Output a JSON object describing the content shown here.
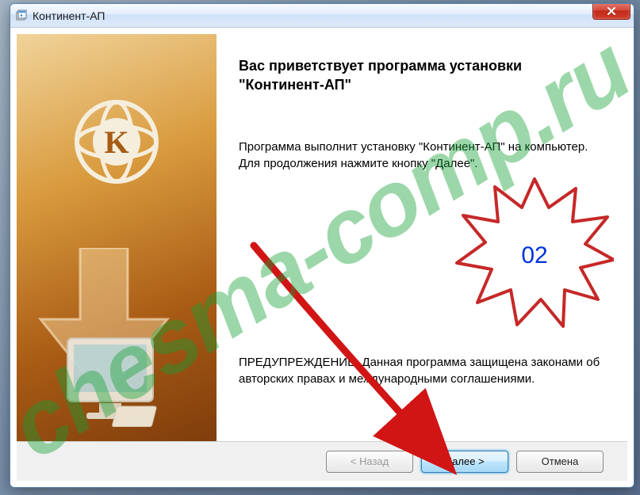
{
  "titlebar": {
    "title": "Континент-АП"
  },
  "wizard": {
    "heading": "Вас приветствует программа установки \"Континент-АП\"",
    "intro": "Программа выполнит установку \"Континент-АП\" на компьютер. Для продолжения нажмите кнопку \"Далее\".",
    "warning": "ПРЕДУПРЕЖДЕНИЕ. Данная программа защищена законами об авторских правах и международными соглашениями."
  },
  "buttons": {
    "back": "< Назад",
    "next": "Далее >",
    "cancel": "Отмена"
  },
  "annotations": {
    "step_number": "02",
    "watermark": "chesma-comp.ru"
  },
  "colors": {
    "accent": "#3c7fb1",
    "side_gradient_from": "#f0d39a",
    "side_gradient_to": "#7f3d0c",
    "close_red": "#c12c1a",
    "watermark_green": "rgba(20,160,50,0.42)",
    "step_blue": "#0033dd",
    "arrow_red": "#d11414"
  },
  "icons": {
    "installer": "installer-icon",
    "close": "close-icon",
    "brand": "continent-k-logo",
    "down_arrow": "downward-arrow-graphic",
    "monitor": "computer-monitor-graphic"
  }
}
